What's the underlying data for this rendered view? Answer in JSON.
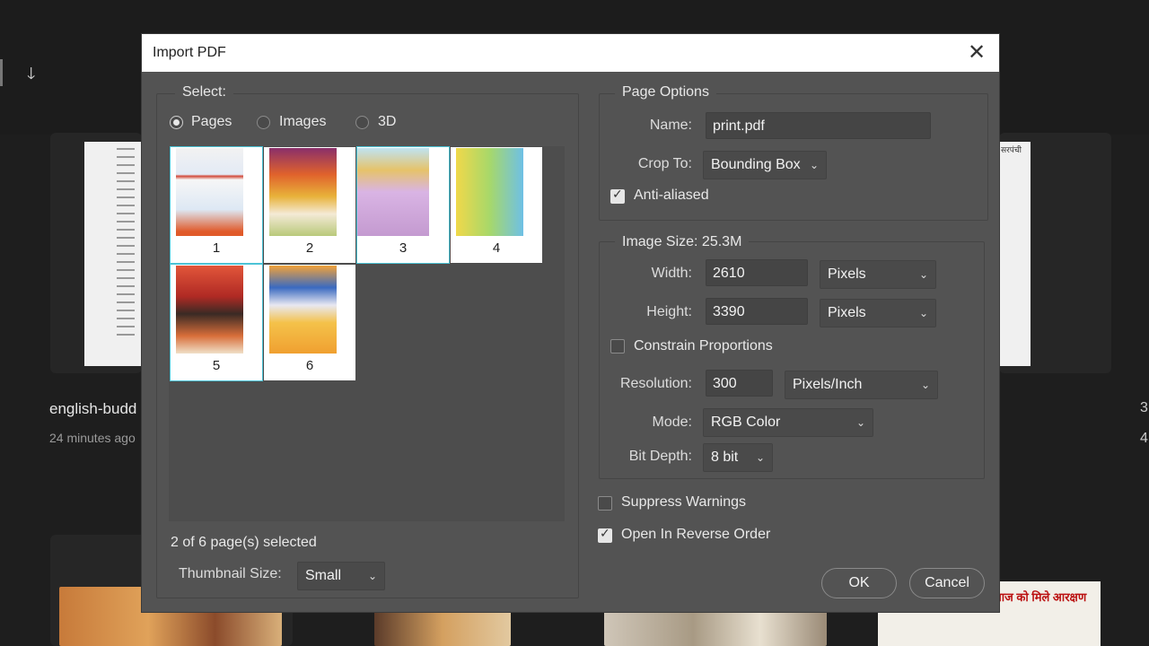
{
  "background": {
    "doc_title": "english-budd",
    "doc_time": "24 minutes ago",
    "right_nums": [
      "3",
      "4"
    ],
    "news_headline": "माज को मिले आरक्षण",
    "news_side_text": "सरपंची"
  },
  "dialog": {
    "title": "Import PDF",
    "close_icon": "close-icon"
  },
  "select": {
    "legend": "Select:",
    "options": [
      {
        "label": "Pages",
        "checked": true
      },
      {
        "label": "Images",
        "checked": false
      },
      {
        "label": "3D",
        "checked": false
      }
    ]
  },
  "thumbnails": [
    {
      "number": "1",
      "selected": true,
      "color": "#d9e4f2"
    },
    {
      "number": "2",
      "selected": false,
      "color": "#d4632a"
    },
    {
      "number": "3",
      "selected": true,
      "color": "#c9a8d6"
    },
    {
      "number": "4",
      "selected": false,
      "color": "#b7e06a"
    },
    {
      "number": "5",
      "selected": true,
      "color": "#b03026"
    },
    {
      "number": "6",
      "selected": false,
      "color": "#f2b53a"
    }
  ],
  "selection_status": "2 of 6 page(s) selected",
  "thumbnail_size": {
    "label": "Thumbnail Size:",
    "value": "Small"
  },
  "page_options": {
    "legend": "Page Options",
    "name_label": "Name:",
    "name_value": "print.pdf",
    "crop_label": "Crop To:",
    "crop_value": "Bounding Box",
    "anti_aliased_label": "Anti-aliased",
    "anti_aliased": true
  },
  "image_size": {
    "legend": "Image Size: 25.3M",
    "width_label": "Width:",
    "width_value": "2610",
    "width_unit": "Pixels",
    "height_label": "Height:",
    "height_value": "3390",
    "height_unit": "Pixels",
    "constrain_label": "Constrain Proportions",
    "constrain": false,
    "resolution_label": "Resolution:",
    "resolution_value": "300",
    "resolution_unit": "Pixels/Inch",
    "mode_label": "Mode:",
    "mode_value": "RGB Color",
    "bitdepth_label": "Bit Depth:",
    "bitdepth_value": "8 bit"
  },
  "suppress_warnings": {
    "label": "Suppress Warnings",
    "checked": false
  },
  "reverse_order": {
    "label": "Open In Reverse Order",
    "checked": true
  },
  "buttons": {
    "ok": "OK",
    "cancel": "Cancel"
  }
}
